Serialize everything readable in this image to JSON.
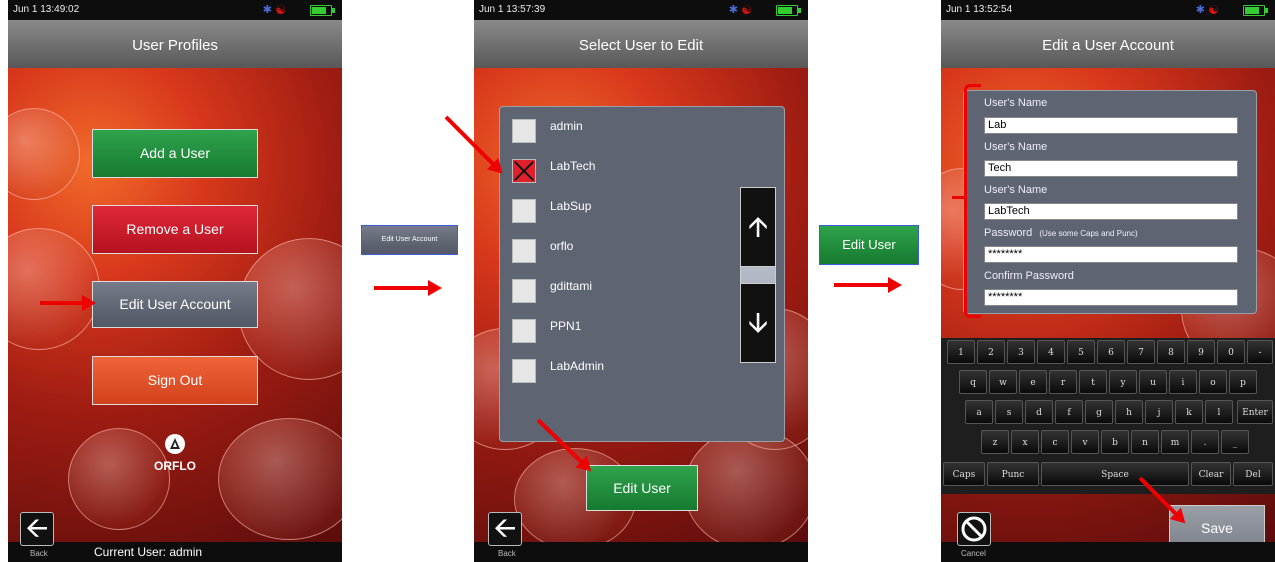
{
  "screen1": {
    "status_time": "Jun  1 13:49:02",
    "title": "User Profiles",
    "buttons": {
      "add": "Add a User",
      "remove": "Remove a User",
      "edit": "Edit User Account",
      "signout": "Sign Out"
    },
    "logo_text": "ORFLO",
    "back_label": "Back",
    "current_user": "Current User: admin"
  },
  "between1": {
    "callout_button": "Edit User Account"
  },
  "screen2": {
    "status_time": "Jun  1 13:57:39",
    "title": "Select User to Edit",
    "users": [
      {
        "name": "admin",
        "selected": false
      },
      {
        "name": "LabTech",
        "selected": true
      },
      {
        "name": "LabSup",
        "selected": false
      },
      {
        "name": "orflo",
        "selected": false
      },
      {
        "name": "gdittami",
        "selected": false
      },
      {
        "name": "PPN1",
        "selected": false
      },
      {
        "name": "LabAdmin",
        "selected": false
      }
    ],
    "edit_button": "Edit User",
    "back_label": "Back"
  },
  "between2": {
    "callout_button": "Edit User"
  },
  "screen3": {
    "status_time": "Jun  1 13:52:54",
    "title": "Edit a User Account",
    "fields": [
      {
        "label": "User's Name",
        "value": "Lab"
      },
      {
        "label": "User's Name",
        "value": "Tech"
      },
      {
        "label": "User's Name",
        "value": "LabTech"
      },
      {
        "label": "Password",
        "hint": "(Use some Caps and Punc)",
        "value": "********"
      },
      {
        "label": "Confirm Password",
        "value": "********"
      }
    ],
    "keyboard": {
      "row1": [
        "1",
        "2",
        "3",
        "4",
        "5",
        "6",
        "7",
        "8",
        "9",
        "0",
        "-"
      ],
      "row2": [
        "q",
        "w",
        "e",
        "r",
        "t",
        "y",
        "u",
        "i",
        "o",
        "p"
      ],
      "row3": [
        "a",
        "s",
        "d",
        "f",
        "g",
        "h",
        "j",
        "k",
        "l",
        "Enter"
      ],
      "row4": [
        "z",
        "x",
        "c",
        "v",
        "b",
        "n",
        "m",
        ".",
        "_"
      ],
      "row5": [
        "Caps",
        "Punc",
        "Space",
        "Clear",
        "Del"
      ]
    },
    "save_button": "Save",
    "cancel_label": "Cancel"
  },
  "colors": {
    "green": "#1f8f3c",
    "red": "#d81b2b",
    "slate": "#60656f",
    "orange": "#e0552a",
    "arrow": "#e00000"
  }
}
